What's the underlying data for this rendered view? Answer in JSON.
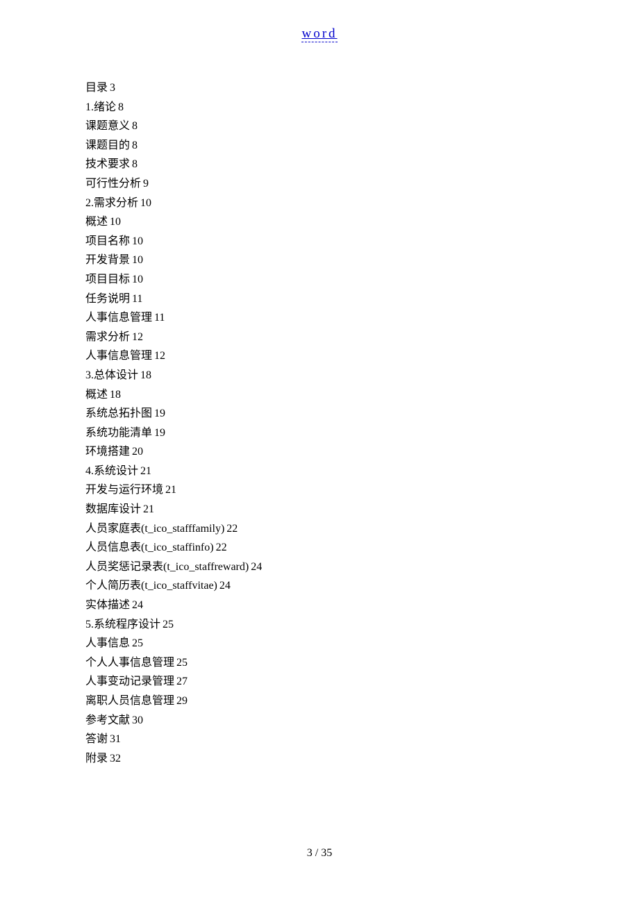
{
  "header": {
    "link_text": "word"
  },
  "toc_entries": [
    {
      "title": "目录",
      "page": "3"
    },
    {
      "title": "1.绪论",
      "page": "8"
    },
    {
      "title": "课题意义",
      "page": "8"
    },
    {
      "title": "课题目的",
      "page": "8"
    },
    {
      "title": "技术要求",
      "page": "8"
    },
    {
      "title": "可行性分析",
      "page": "9"
    },
    {
      "title": "2.需求分析",
      "page": "10"
    },
    {
      "title": "概述",
      "page": "10"
    },
    {
      "title": "项目名称",
      "page": "10"
    },
    {
      "title": "开发背景",
      "page": "10"
    },
    {
      "title": "项目目标",
      "page": "10"
    },
    {
      "title": "任务说明",
      "page": "11"
    },
    {
      "title": "人事信息管理",
      "page": "11"
    },
    {
      "title": "需求分析",
      "page": "12"
    },
    {
      "title": "人事信息管理",
      "page": "12"
    },
    {
      "title": "3.总体设计",
      "page": "18"
    },
    {
      "title": "概述",
      "page": "18"
    },
    {
      "title": "系统总拓扑图",
      "page": "19"
    },
    {
      "title": "系统功能清单",
      "page": "19"
    },
    {
      "title": "环境搭建",
      "page": "20"
    },
    {
      "title": "4.系统设计",
      "page": "21"
    },
    {
      "title": "开发与运行环境",
      "page": "21"
    },
    {
      "title": "数据库设计",
      "page": "21"
    },
    {
      "title": "人员家庭表(t_ico_stafffamily)",
      "page": "22"
    },
    {
      "title": "人员信息表(t_ico_staffinfo)",
      "page": "22"
    },
    {
      "title": "人员奖惩记录表(t_ico_staffreward)",
      "page": "24"
    },
    {
      "title": "个人简历表(t_ico_staffvitae)",
      "page": "24"
    },
    {
      "title": "实体描述",
      "page": "24"
    },
    {
      "title": "5.系统程序设计",
      "page": "25"
    },
    {
      "title": "人事信息",
      "page": "25"
    },
    {
      "title": "个人人事信息管理",
      "page": "25"
    },
    {
      "title": "人事变动记录管理",
      "page": "27"
    },
    {
      "title": "离职人员信息管理",
      "page": "29"
    },
    {
      "title": "参考文献",
      "page": "30"
    },
    {
      "title": "答谢",
      "page": "31"
    },
    {
      "title": "附录",
      "page": "32"
    }
  ],
  "footer": {
    "page_indicator": "3 / 35"
  }
}
